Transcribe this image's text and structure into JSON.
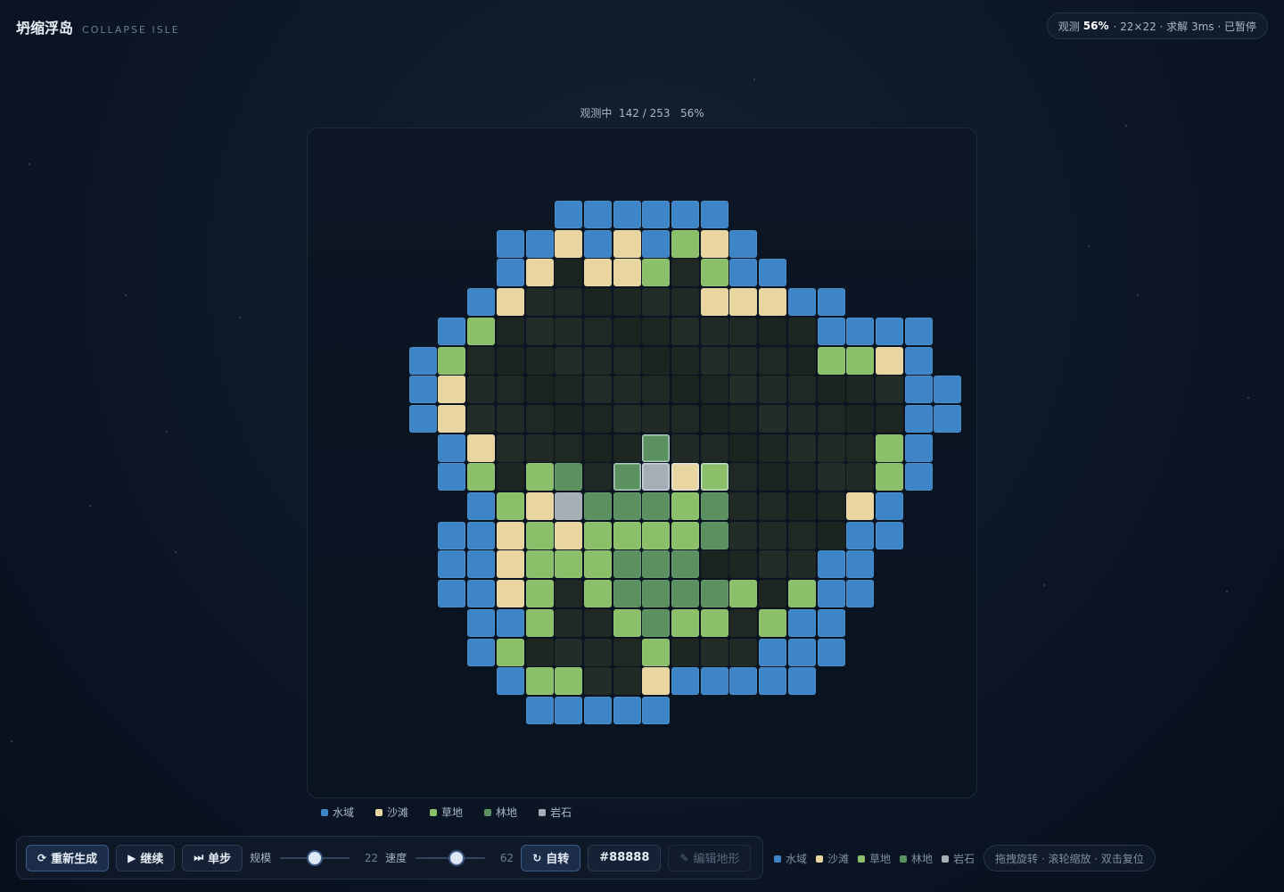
{
  "brand": {
    "title": "坍缩浮岛",
    "subtitle": "COLLAPSE ISLE"
  },
  "status": {
    "observe_label": "观测",
    "observe_pct": "56%",
    "details": "· 22×22 · 求解 3ms · 已暂停"
  },
  "progress": {
    "label": "观测中",
    "count": "142 / 253",
    "pct": "56%"
  },
  "legend": [
    {
      "name": "水域",
      "color": "#3d85c6"
    },
    {
      "name": "沙滩",
      "color": "#e8d5a0"
    },
    {
      "name": "草地",
      "color": "#8cbf6a"
    },
    {
      "name": "林地",
      "color": "#5b9160"
    },
    {
      "name": "岩石",
      "color": "#a5adb5"
    }
  ],
  "toolbar": {
    "regenerate": "重新生成",
    "continue": "继续",
    "step": "单步",
    "scale_label": "规模",
    "scale_value": "22",
    "scale_fraction": 0.5,
    "speed_label": "速度",
    "speed_value": "62",
    "speed_fraction": 0.6,
    "autorotate": "自转",
    "seed": "#88888",
    "edit": "编辑地形"
  },
  "hint": "拖拽旋转 · 滚轮缩放 · 双击复位",
  "icons": {
    "regenerate": "refresh-icon",
    "continue": "play-icon",
    "step": "step-forward-icon",
    "autorotate": "rotate-icon",
    "edit": "pencil-icon"
  },
  "colors": {
    "W": "#3d85c6",
    "S": "#e8d5a0",
    "G": "#8cbf6a",
    "F": "#5b9160",
    "R": "#a5adb5",
    "U": "#1f2a25"
  },
  "map_rows": [
    "......WWWWWW.........",
    "....WWSWSWGSW........",
    "....WSUSSGUGWW.......",
    "...WSUUUUUUSSSWW.....",
    "..WGUUUUUUUUUUUWWWW..",
    ".WGUUUUUUUUUUUUGGSW..",
    ".WSUUUUUUUUUUUUUUUWW.",
    ".WSUUUUUUUUUUUUUUUWW.",
    "..WSUUUUUFUUUUUUUGW..",
    "..WGUGFUFRSGUUUUUGW..",
    "...WGSRFFFGFUUUUSW...",
    "..WWSGSGGGGFUUUUWW...",
    "..WWSGGGFFFUUUUWW....",
    "..WWSGUGFFFFGUGWW....",
    "...WWGUUGFGGUGWW.....",
    "...WGUUUUGUUUWWW.....",
    "....WGGUUSWWWWW......",
    ".....WWWWW..........."
  ],
  "active_cells": [
    "8,9",
    "9,8",
    "9,9",
    "9,10",
    "9,11"
  ]
}
